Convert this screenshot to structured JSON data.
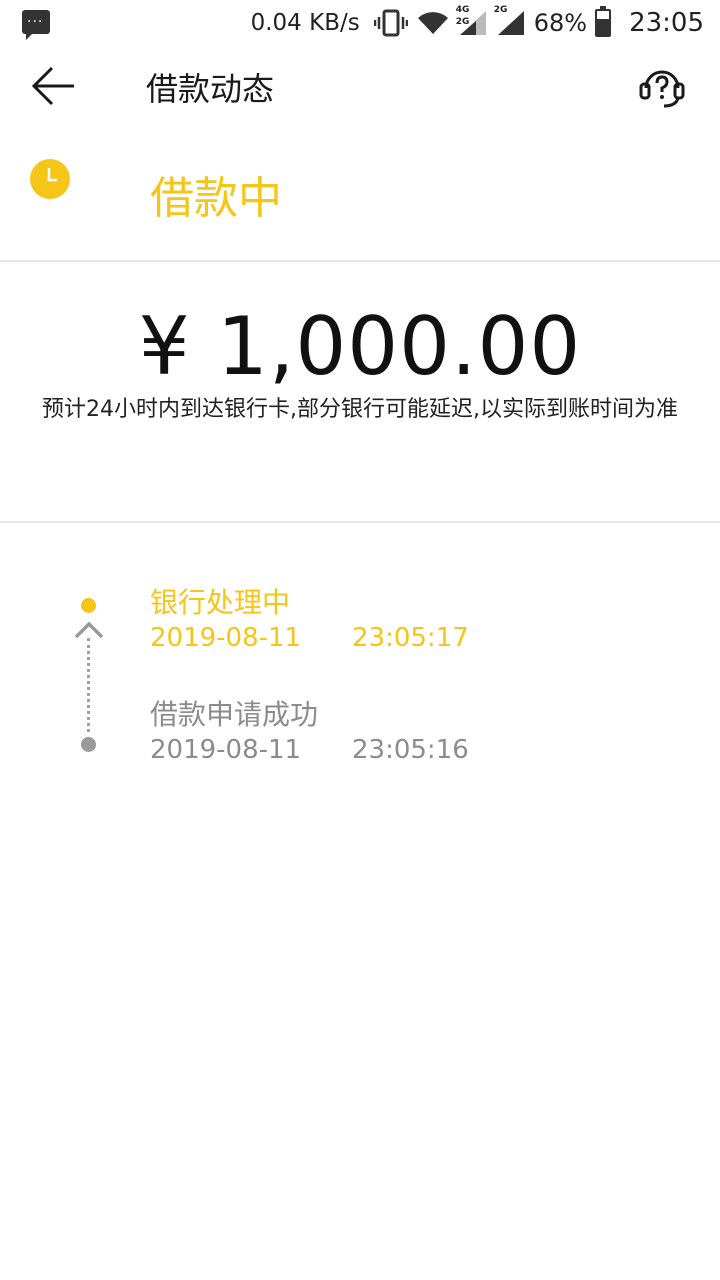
{
  "status_bar": {
    "speed": "0.04 KB/s",
    "net_label_1": "4G",
    "net_label_2": "2G",
    "net_label_3": "2G",
    "battery": "68%",
    "battery_level": 0.68,
    "time": "23:05"
  },
  "header": {
    "title": "借款动态"
  },
  "status": {
    "text": "借款中"
  },
  "amount": {
    "value": "¥ 1,000.00",
    "note": "预计24小时内到达银行卡,部分银行可能延迟,以实际到账时间为准"
  },
  "timeline": [
    {
      "label": "银行处理中",
      "date": "2019-08-11",
      "time": "23:05:17"
    },
    {
      "label": "借款申请成功",
      "date": "2019-08-11",
      "time": "23:05:16"
    }
  ],
  "colors": {
    "accent": "#f5c518",
    "muted": "#8c8c8c"
  }
}
